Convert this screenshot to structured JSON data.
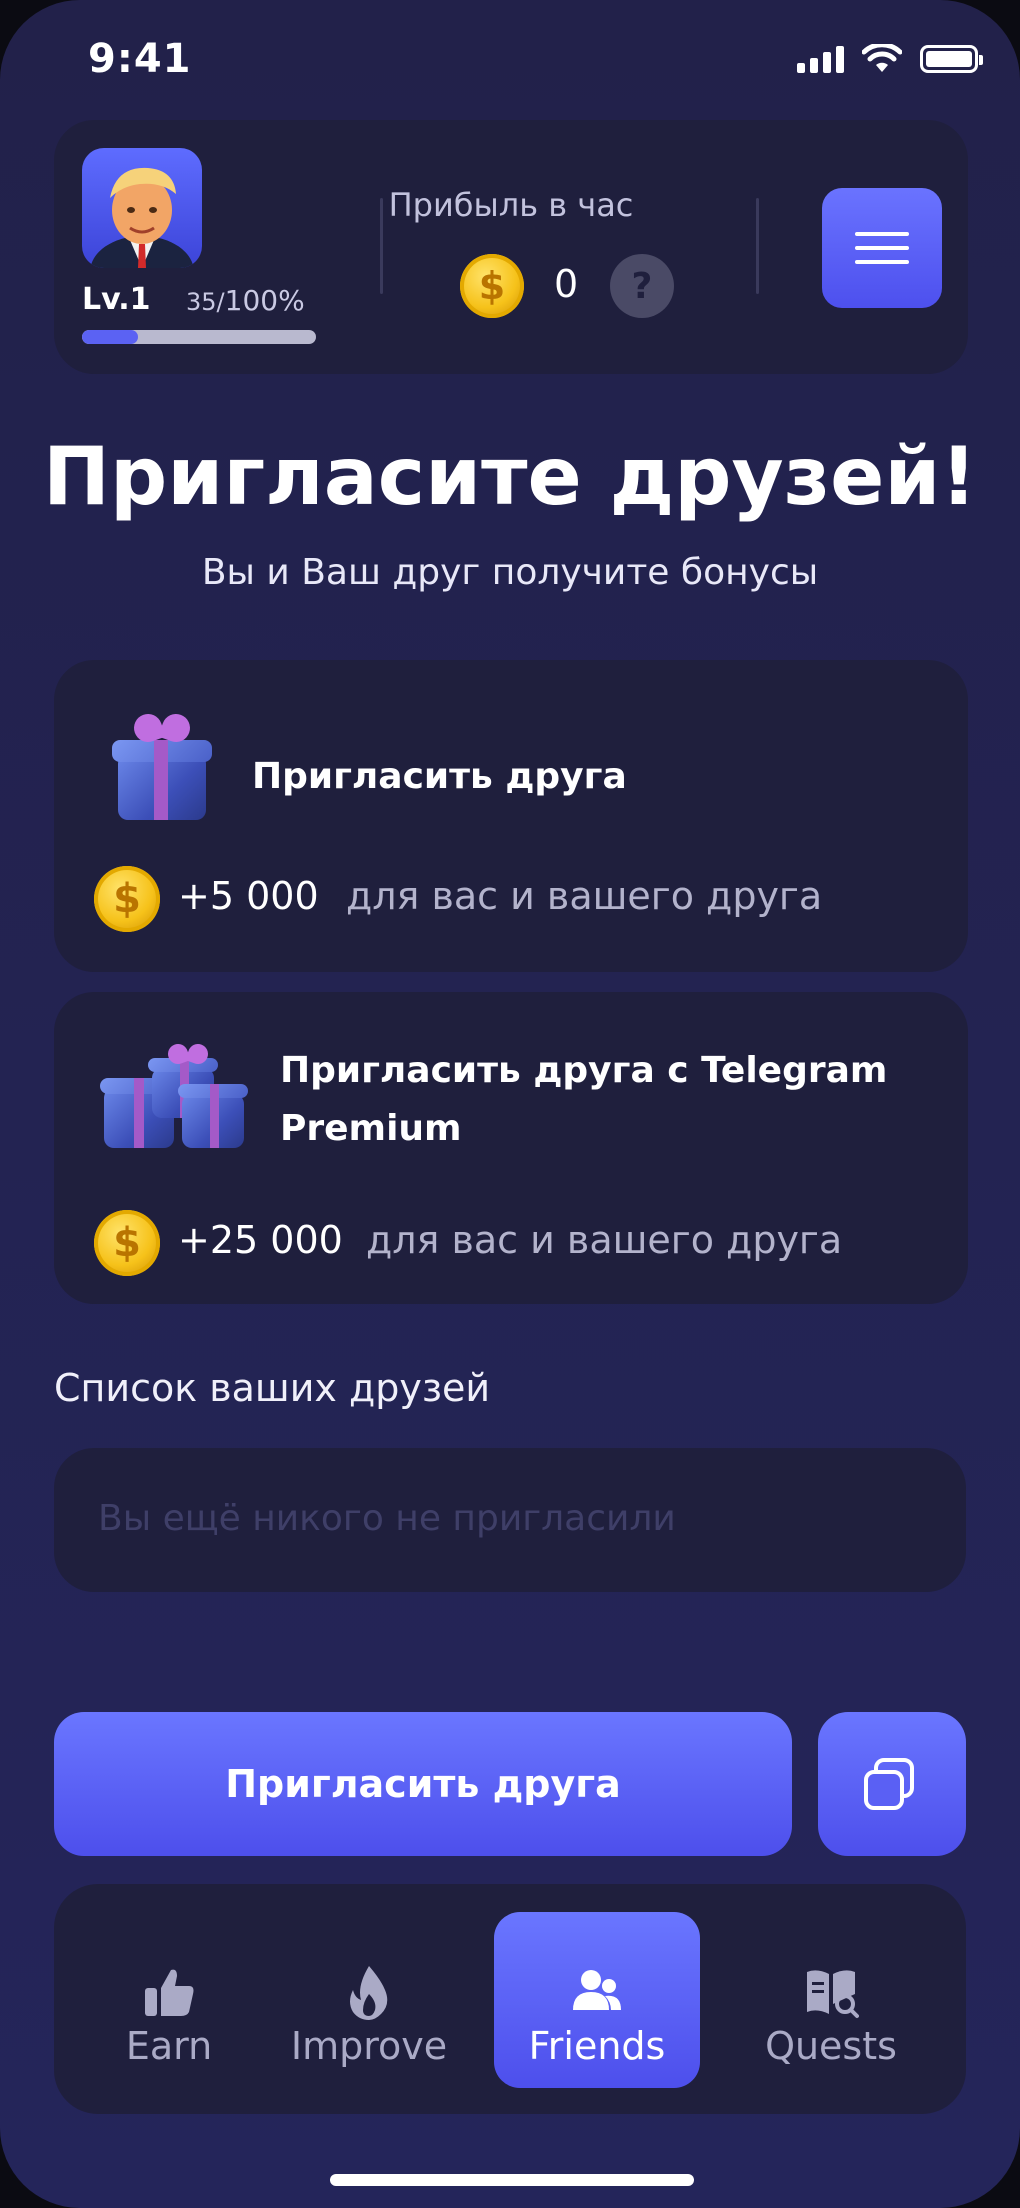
{
  "status_bar": {
    "time": "9:41"
  },
  "header": {
    "level": "Lv.1",
    "progress_current": "35/",
    "progress_percent": "100%",
    "level_progress_fraction": 0.24,
    "profit_label": "Прибыль в час",
    "profit_value": "0",
    "help_symbol": "?",
    "coin_symbol": "$"
  },
  "page": {
    "title": "Пригласите друзей!",
    "subtitle": "Вы и Ваш друг получите бонусы"
  },
  "cards": [
    {
      "title": "Пригласить друга",
      "amount": "+5 000",
      "text": "для вас и вашего друга"
    },
    {
      "title_line1": "Пригласить друга с Telegram",
      "title_line2": "Premium",
      "amount": "+25 000",
      "text": "для вас и вашего друга"
    }
  ],
  "friends": {
    "title": "Список ваших друзей",
    "empty": "Вы ещё никого не пригласили"
  },
  "actions": {
    "invite_label": "Пригласить друга"
  },
  "nav": [
    {
      "label": "Earn",
      "icon": "thumbs-up-icon"
    },
    {
      "label": "Improve",
      "icon": "flame-icon"
    },
    {
      "label": "Friends",
      "icon": "users-icon",
      "active": true
    },
    {
      "label": "Quests",
      "icon": "book-search-icon"
    }
  ],
  "colors": {
    "background": "#22214a",
    "card": "#1f1f3d",
    "accent": "#5b62f3",
    "muted_text": "#b3b3cc"
  }
}
